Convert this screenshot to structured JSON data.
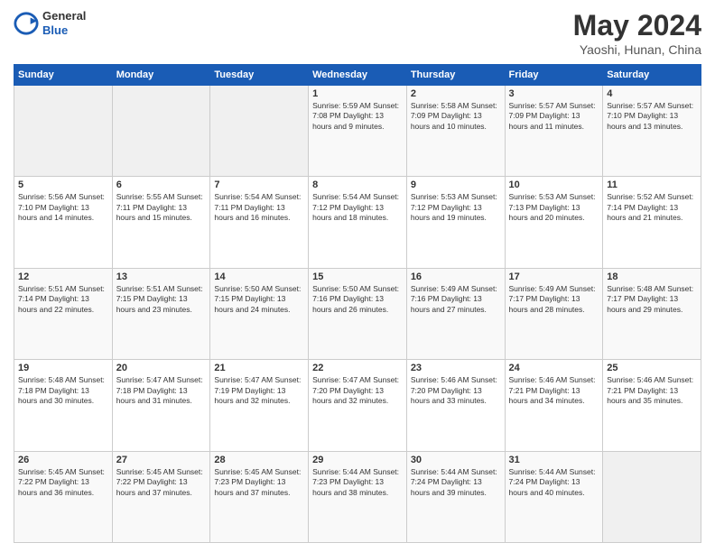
{
  "header": {
    "logo_general": "General",
    "logo_blue": "Blue",
    "title": "May 2024",
    "subtitle": "Yaoshi, Hunan, China"
  },
  "weekdays": [
    "Sunday",
    "Monday",
    "Tuesday",
    "Wednesday",
    "Thursday",
    "Friday",
    "Saturday"
  ],
  "weeks": [
    [
      {
        "day": "",
        "content": ""
      },
      {
        "day": "",
        "content": ""
      },
      {
        "day": "",
        "content": ""
      },
      {
        "day": "1",
        "content": "Sunrise: 5:59 AM\nSunset: 7:08 PM\nDaylight: 13 hours\nand 9 minutes."
      },
      {
        "day": "2",
        "content": "Sunrise: 5:58 AM\nSunset: 7:09 PM\nDaylight: 13 hours\nand 10 minutes."
      },
      {
        "day": "3",
        "content": "Sunrise: 5:57 AM\nSunset: 7:09 PM\nDaylight: 13 hours\nand 11 minutes."
      },
      {
        "day": "4",
        "content": "Sunrise: 5:57 AM\nSunset: 7:10 PM\nDaylight: 13 hours\nand 13 minutes."
      }
    ],
    [
      {
        "day": "5",
        "content": "Sunrise: 5:56 AM\nSunset: 7:10 PM\nDaylight: 13 hours\nand 14 minutes."
      },
      {
        "day": "6",
        "content": "Sunrise: 5:55 AM\nSunset: 7:11 PM\nDaylight: 13 hours\nand 15 minutes."
      },
      {
        "day": "7",
        "content": "Sunrise: 5:54 AM\nSunset: 7:11 PM\nDaylight: 13 hours\nand 16 minutes."
      },
      {
        "day": "8",
        "content": "Sunrise: 5:54 AM\nSunset: 7:12 PM\nDaylight: 13 hours\nand 18 minutes."
      },
      {
        "day": "9",
        "content": "Sunrise: 5:53 AM\nSunset: 7:12 PM\nDaylight: 13 hours\nand 19 minutes."
      },
      {
        "day": "10",
        "content": "Sunrise: 5:53 AM\nSunset: 7:13 PM\nDaylight: 13 hours\nand 20 minutes."
      },
      {
        "day": "11",
        "content": "Sunrise: 5:52 AM\nSunset: 7:14 PM\nDaylight: 13 hours\nand 21 minutes."
      }
    ],
    [
      {
        "day": "12",
        "content": "Sunrise: 5:51 AM\nSunset: 7:14 PM\nDaylight: 13 hours\nand 22 minutes."
      },
      {
        "day": "13",
        "content": "Sunrise: 5:51 AM\nSunset: 7:15 PM\nDaylight: 13 hours\nand 23 minutes."
      },
      {
        "day": "14",
        "content": "Sunrise: 5:50 AM\nSunset: 7:15 PM\nDaylight: 13 hours\nand 24 minutes."
      },
      {
        "day": "15",
        "content": "Sunrise: 5:50 AM\nSunset: 7:16 PM\nDaylight: 13 hours\nand 26 minutes."
      },
      {
        "day": "16",
        "content": "Sunrise: 5:49 AM\nSunset: 7:16 PM\nDaylight: 13 hours\nand 27 minutes."
      },
      {
        "day": "17",
        "content": "Sunrise: 5:49 AM\nSunset: 7:17 PM\nDaylight: 13 hours\nand 28 minutes."
      },
      {
        "day": "18",
        "content": "Sunrise: 5:48 AM\nSunset: 7:17 PM\nDaylight: 13 hours\nand 29 minutes."
      }
    ],
    [
      {
        "day": "19",
        "content": "Sunrise: 5:48 AM\nSunset: 7:18 PM\nDaylight: 13 hours\nand 30 minutes."
      },
      {
        "day": "20",
        "content": "Sunrise: 5:47 AM\nSunset: 7:18 PM\nDaylight: 13 hours\nand 31 minutes."
      },
      {
        "day": "21",
        "content": "Sunrise: 5:47 AM\nSunset: 7:19 PM\nDaylight: 13 hours\nand 32 minutes."
      },
      {
        "day": "22",
        "content": "Sunrise: 5:47 AM\nSunset: 7:20 PM\nDaylight: 13 hours\nand 32 minutes."
      },
      {
        "day": "23",
        "content": "Sunrise: 5:46 AM\nSunset: 7:20 PM\nDaylight: 13 hours\nand 33 minutes."
      },
      {
        "day": "24",
        "content": "Sunrise: 5:46 AM\nSunset: 7:21 PM\nDaylight: 13 hours\nand 34 minutes."
      },
      {
        "day": "25",
        "content": "Sunrise: 5:46 AM\nSunset: 7:21 PM\nDaylight: 13 hours\nand 35 minutes."
      }
    ],
    [
      {
        "day": "26",
        "content": "Sunrise: 5:45 AM\nSunset: 7:22 PM\nDaylight: 13 hours\nand 36 minutes."
      },
      {
        "day": "27",
        "content": "Sunrise: 5:45 AM\nSunset: 7:22 PM\nDaylight: 13 hours\nand 37 minutes."
      },
      {
        "day": "28",
        "content": "Sunrise: 5:45 AM\nSunset: 7:23 PM\nDaylight: 13 hours\nand 37 minutes."
      },
      {
        "day": "29",
        "content": "Sunrise: 5:44 AM\nSunset: 7:23 PM\nDaylight: 13 hours\nand 38 minutes."
      },
      {
        "day": "30",
        "content": "Sunrise: 5:44 AM\nSunset: 7:24 PM\nDaylight: 13 hours\nand 39 minutes."
      },
      {
        "day": "31",
        "content": "Sunrise: 5:44 AM\nSunset: 7:24 PM\nDaylight: 13 hours\nand 40 minutes."
      },
      {
        "day": "",
        "content": ""
      }
    ]
  ]
}
